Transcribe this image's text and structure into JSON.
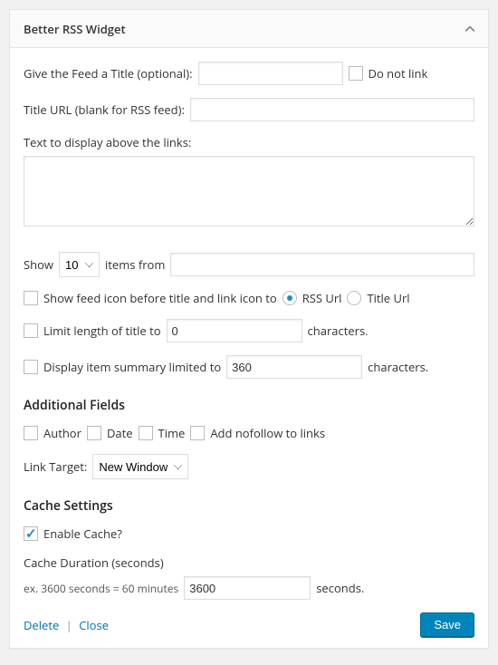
{
  "header": {
    "title": "Better RSS Widget"
  },
  "form": {
    "title_label": "Give the Feed a Title (optional):",
    "title_value": "",
    "no_link_label": "Do not link",
    "no_link_checked": false,
    "title_url_label": "Title URL (blank for RSS feed):",
    "title_url_value": "",
    "intro_label": "Text to display above the links:",
    "intro_value": "",
    "show_label_pre": "Show",
    "show_count": "10",
    "show_label_post": "items from",
    "items_from_value": "",
    "feed_icon_label": "Show feed icon before title and link icon to",
    "feed_icon_checked": false,
    "link_to": {
      "rss": "RSS Url",
      "title": "Title Url",
      "selected": "rss"
    },
    "limit_title_label": "Limit length of title to",
    "limit_title_checked": false,
    "limit_title_value": "0",
    "characters": "characters.",
    "summary_label": "Display item summary limited to",
    "summary_checked": false,
    "summary_value": "360"
  },
  "additional": {
    "heading": "Additional Fields",
    "author": {
      "label": "Author",
      "checked": false
    },
    "date": {
      "label": "Date",
      "checked": false
    },
    "time": {
      "label": "Time",
      "checked": false
    },
    "nofollow": {
      "label": "Add nofollow to links",
      "checked": false
    },
    "link_target_label": "Link Target:",
    "link_target_value": "New Window"
  },
  "cache": {
    "heading": "Cache Settings",
    "enable_label": "Enable Cache?",
    "enable_checked": true,
    "duration_label": "Cache Duration (seconds)",
    "hint": "ex. 3600 seconds = 60 minutes",
    "duration_value": "3600",
    "seconds": "seconds."
  },
  "footer": {
    "delete": "Delete",
    "close": "Close",
    "save": "Save"
  }
}
